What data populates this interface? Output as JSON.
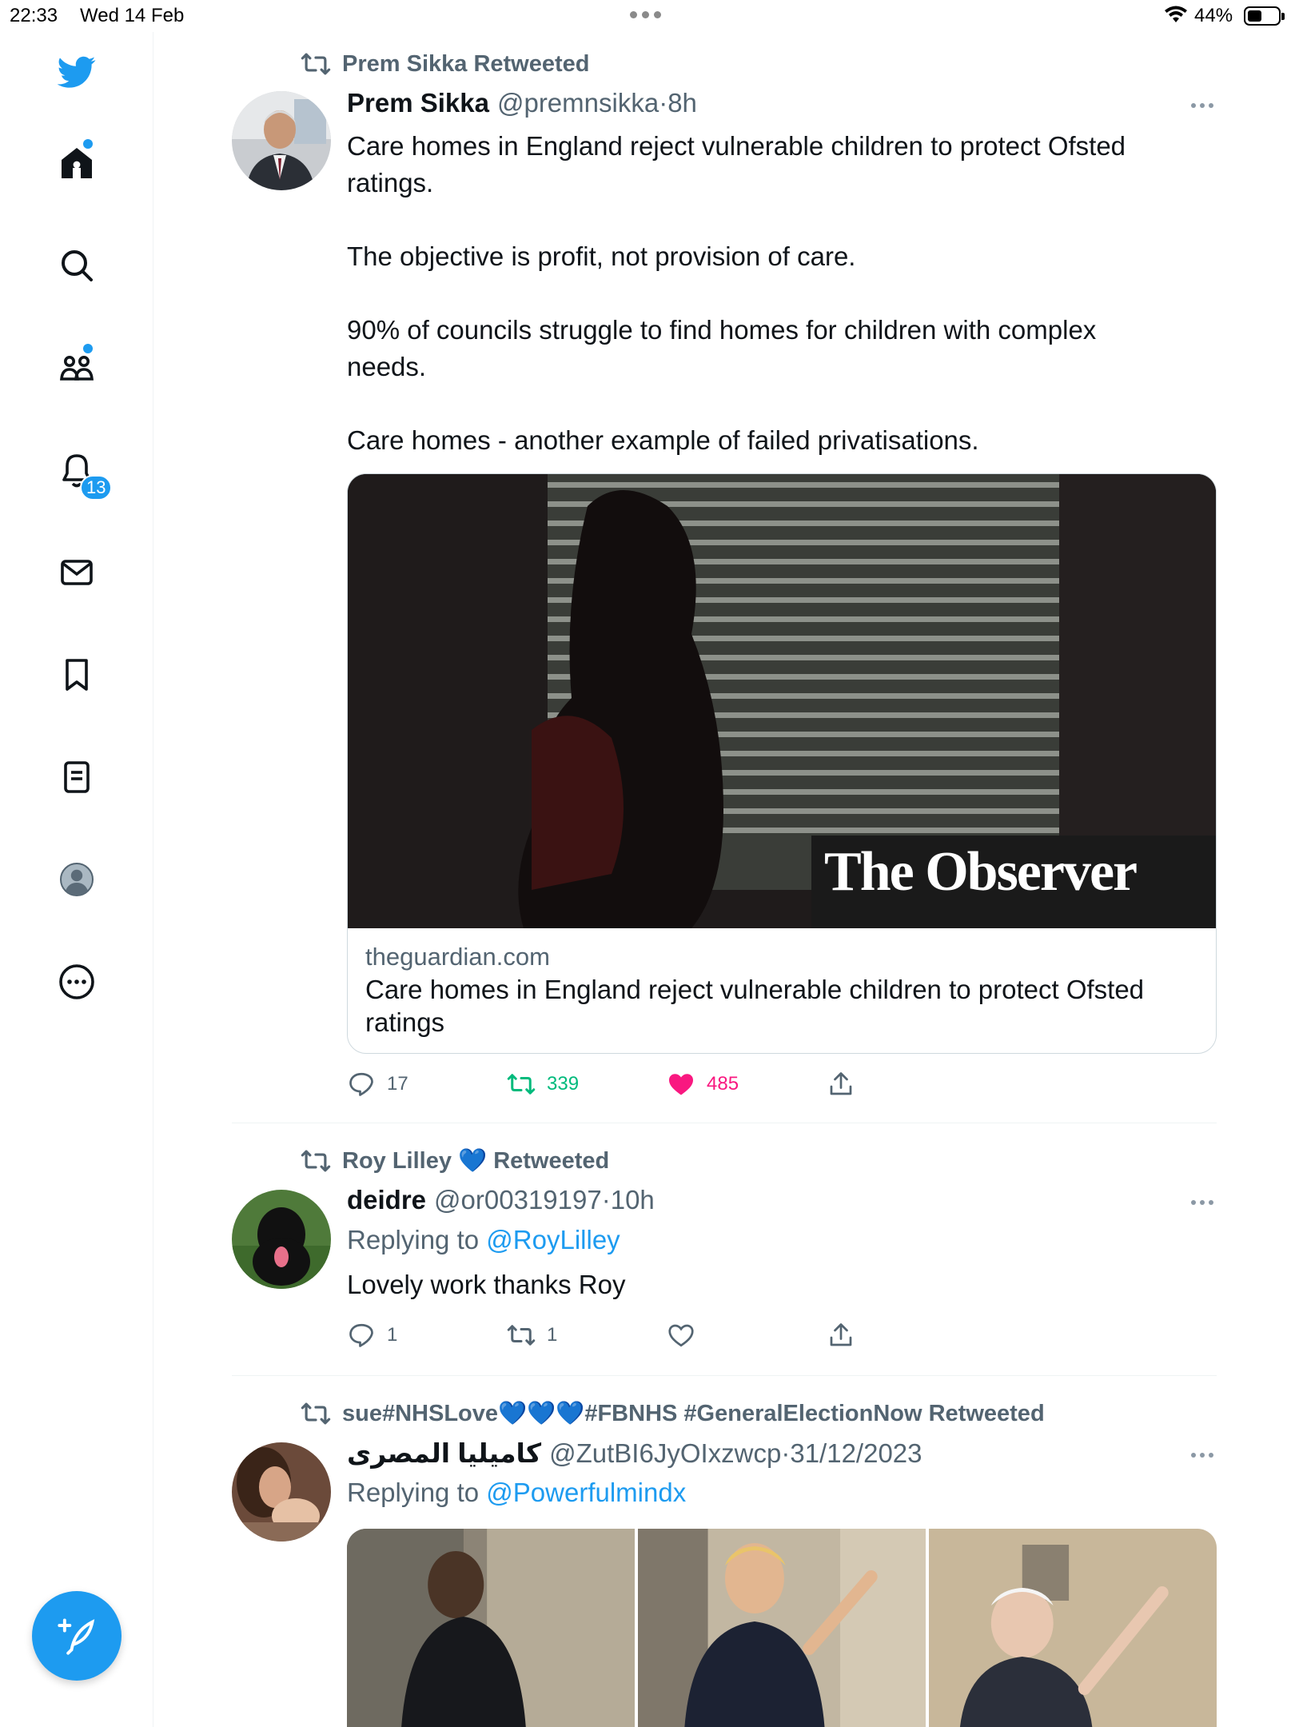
{
  "status_bar": {
    "time": "22:33",
    "date": "Wed 14 Feb",
    "battery": "44%"
  },
  "sidebar": {
    "items": [
      {
        "icon": "twitter-logo"
      },
      {
        "icon": "home-icon",
        "has_dot": true
      },
      {
        "icon": "search-icon"
      },
      {
        "icon": "communities-icon",
        "has_dot": true
      },
      {
        "icon": "notifications-icon",
        "badge": "13"
      },
      {
        "icon": "messages-icon"
      },
      {
        "icon": "bookmarks-icon"
      },
      {
        "icon": "lists-icon"
      },
      {
        "icon": "profile-icon"
      },
      {
        "icon": "more-icon"
      }
    ],
    "notifications_badge": "13",
    "compose_icon": "compose-icon"
  },
  "colors": {
    "accent": "#1d9bf0",
    "retweet": "#00ba7c",
    "like": "#f91880",
    "muted": "#536471",
    "text": "#0f1419"
  },
  "tweets": [
    {
      "retweeted_by": "Prem Sikka Retweeted",
      "name": "Prem Sikka",
      "handle": "@premnsikka",
      "sep": "·",
      "time": "8h",
      "text": "Care homes in England reject vulnerable children to protect Ofsted ratings.\n\nThe objective is profit, not provision of care.\n\n90% of councils struggle to find homes for children with complex needs.\n\nCare homes - another example of failed privatisations.",
      "card": {
        "brand": "The Observer",
        "domain": "theguardian.com",
        "title": "Care homes in England reject vulnerable children to protect Ofsted ratings"
      },
      "actions": {
        "replies": "17",
        "retweets": "339",
        "likes": "485"
      }
    },
    {
      "retweeted_by": "Roy Lilley 💙 Retweeted",
      "name": "deidre",
      "handle": "@or00319197",
      "sep": "·",
      "time": "10h",
      "replying_label": "Replying to",
      "replying_to": "@RoyLilley",
      "text": "Lovely work thanks Roy",
      "actions": {
        "replies": "1",
        "retweets": "1",
        "likes": ""
      }
    },
    {
      "retweeted_by": "sue#NHSLove💙💙💙#FBNHS #GeneralElectionNow Retweeted",
      "name": "كاميليا المصرى",
      "handle": "@ZutBI6JyOIxzwcp",
      "sep": "·",
      "time": "31/12/2023",
      "replying_label": "Replying to",
      "replying_to": "@Powerfulmindx"
    }
  ]
}
